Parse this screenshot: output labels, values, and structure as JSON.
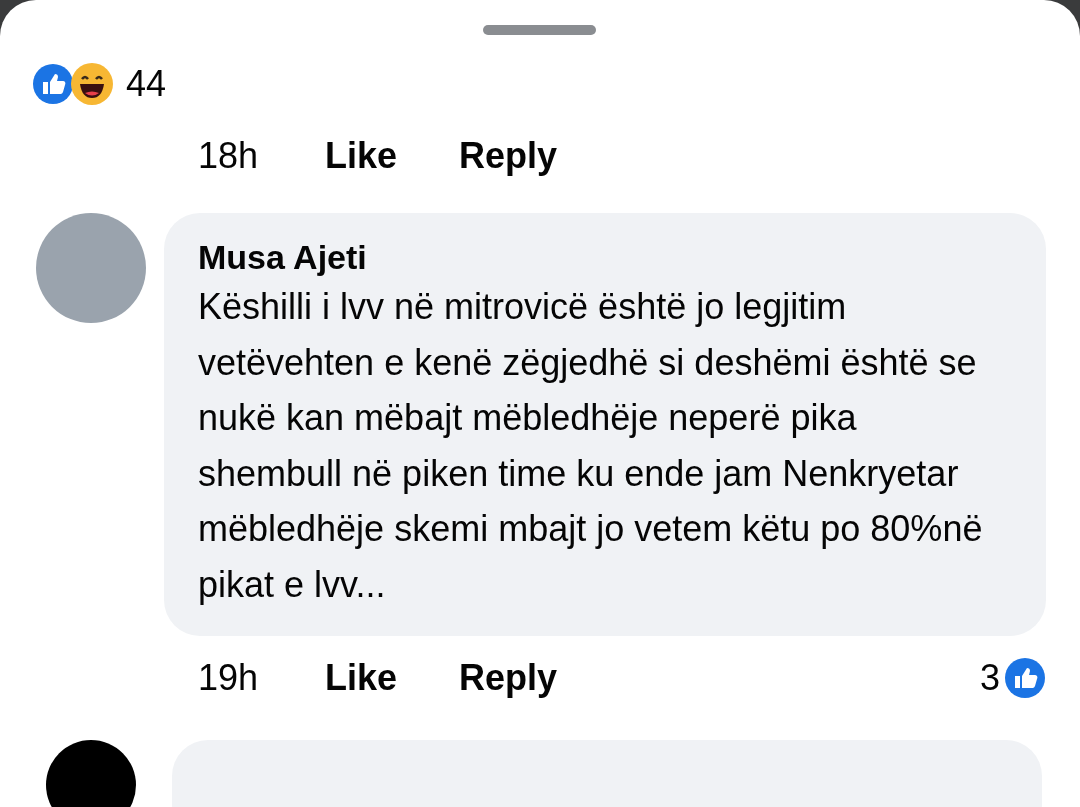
{
  "previous_comment": {
    "reaction_count": "44",
    "time": "18h",
    "like": "Like",
    "reply": "Reply"
  },
  "comment": {
    "author": "Musa Ajeti",
    "text": "Këshilli i lvv në mitrovicë është jo legjitim vetëvehten e kenë zëgjedhë si deshëmi është se nukë kan mëbajt mëbledhëje neperë pika shembull në piken time ku ende jam Nenkryetar mëbledhëje skemi mbajt jo vetem këtu po 80%në pikat e lvv...",
    "time": "19h",
    "like": "Like",
    "reply": "Reply",
    "reaction_count": "3"
  }
}
